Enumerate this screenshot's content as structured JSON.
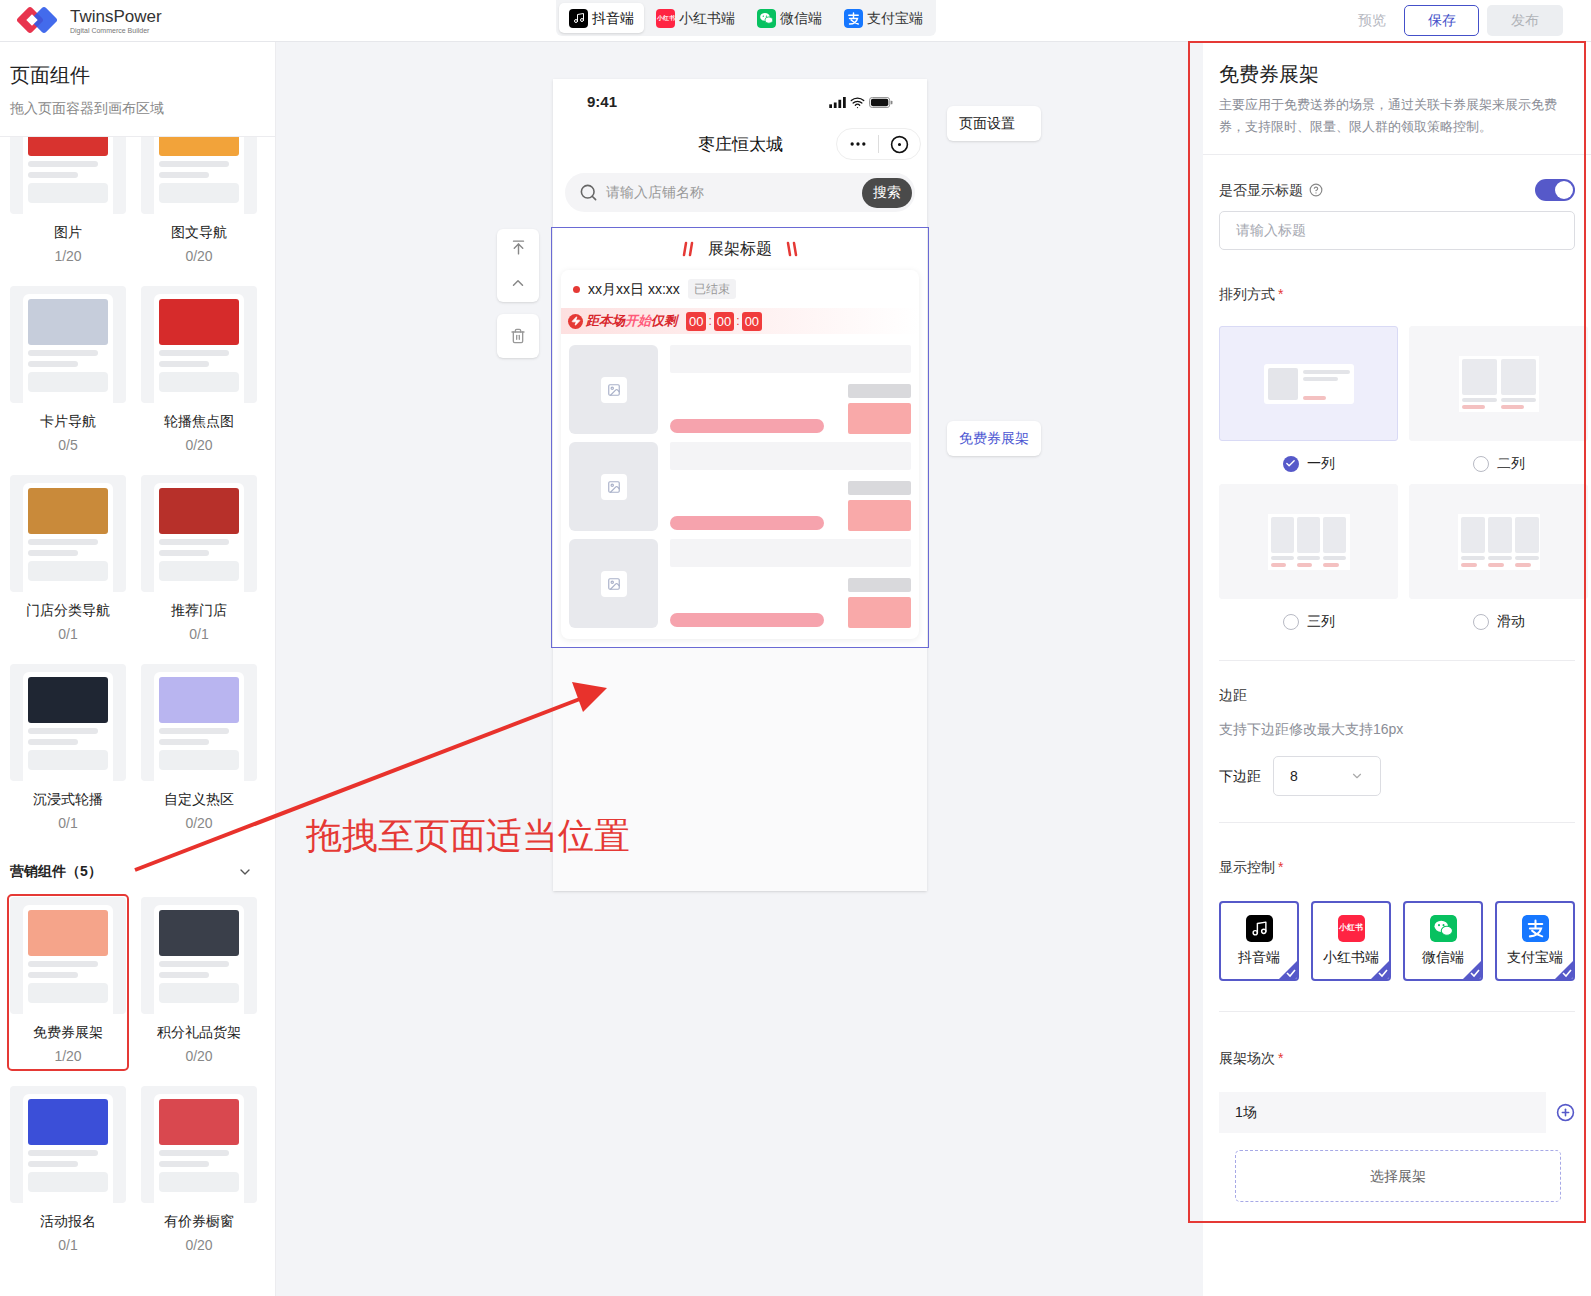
{
  "app": {
    "name": "TwinsPower",
    "tagline": "Digital Commerce Builder"
  },
  "platform_tabs": [
    {
      "label": "抖音端",
      "kind": "douyin",
      "selected": true
    },
    {
      "label": "小红书端",
      "kind": "xiaohongshu",
      "icon_text": "小红书",
      "selected": false
    },
    {
      "label": "微信端",
      "kind": "wechat",
      "selected": false
    },
    {
      "label": "支付宝端",
      "kind": "alipay",
      "selected": false
    }
  ],
  "toolbar": {
    "preview": {
      "label": "预览",
      "disabled": true
    },
    "save": {
      "label": "保存",
      "disabled": false
    },
    "publish": {
      "label": "发布",
      "disabled": true
    }
  },
  "component_panel": {
    "title": "页面组件",
    "subtitle": "拖入页面容器到画布区域",
    "basic_items": [
      {
        "label": "图片",
        "count": "1/20",
        "color": "#d8332f"
      },
      {
        "label": "图文导航",
        "count": "0/20",
        "color": "#f2a33a"
      },
      {
        "label": "卡片导航",
        "count": "0/5",
        "color": "#c6cddb"
      },
      {
        "label": "轮播焦点图",
        "count": "0/20",
        "color": "#d62b2b"
      },
      {
        "label": "门店分类导航",
        "count": "0/1",
        "color": "#c98a3a"
      },
      {
        "label": "推荐门店",
        "count": "0/1",
        "color": "#b7302a"
      },
      {
        "label": "沉浸式轮播",
        "count": "0/1",
        "color": "#1f2633"
      },
      {
        "label": "自定义热区",
        "count": "0/20",
        "color": "#b9b5f0"
      }
    ],
    "marketing_section": {
      "title": "营销组件（5）",
      "expanded": true
    },
    "marketing_items": [
      {
        "label": "免费券展架",
        "count": "1/20",
        "color": "#f5a48a",
        "selected": true
      },
      {
        "label": "积分礼品货架",
        "count": "0/20",
        "color": "#3a3f4a",
        "selected": false
      },
      {
        "label": "活动报名",
        "count": "0/1",
        "color": "#3b4fd8",
        "selected": false
      },
      {
        "label": "有价券橱窗",
        "count": "0/20",
        "color": "#d9484f",
        "selected": false
      }
    ]
  },
  "annotation": {
    "text": "拖拽至页面适当位置"
  },
  "canvas": {
    "page_settings_label": "页面设置",
    "selected_component_label": "免费券展架"
  },
  "phone": {
    "time": "9:41",
    "title": "枣庄恒太城",
    "search_placeholder": "请输入店铺名称",
    "search_button": "搜索",
    "shelf": {
      "title": "展架标题",
      "session_time": "xx月xx日 xx:xx",
      "session_status": "已结束",
      "countdown_label": [
        {
          "text": "距本场",
          "color": "#d8262c"
        },
        {
          "text": "开始",
          "color": "#ff5a7a"
        },
        {
          "text": "仅剩",
          "color": "#d8262c"
        }
      ],
      "countdown": [
        "00",
        "00",
        "00"
      ],
      "countdown_separator": ":",
      "coupons": [
        {
          "kind": "placeholder"
        },
        {
          "kind": "placeholder"
        },
        {
          "kind": "placeholder"
        }
      ]
    }
  },
  "settings": {
    "title": "免费券展架",
    "description": "主要应用于免费送券的场景，通过关联卡券展架来展示免费券，支持限时、限量、限人群的领取策略控制。",
    "required_mark": "*",
    "show_title": {
      "label": "是否显示标题",
      "on": true,
      "placeholder": "请输入标题"
    },
    "layout": {
      "label": "排列方式",
      "required": true,
      "options": [
        {
          "label": "一列",
          "kind": "one",
          "selected": true
        },
        {
          "label": "二列",
          "kind": "two",
          "selected": false
        },
        {
          "label": "三列",
          "kind": "three",
          "selected": false
        },
        {
          "label": "滑动",
          "kind": "slide",
          "selected": false
        }
      ]
    },
    "margin": {
      "label": "边距",
      "hint": "支持下边距修改最大支持16px",
      "field_label": "下边距",
      "value": "8"
    },
    "display_control": {
      "label": "显示控制",
      "required": true,
      "platforms": [
        {
          "label": "抖音端",
          "kind": "douyin",
          "checked": true
        },
        {
          "label": "小红书端",
          "kind": "xiaohongshu",
          "icon_text": "小红书",
          "checked": true
        },
        {
          "label": "微信端",
          "kind": "wechat",
          "checked": true
        },
        {
          "label": "支付宝端",
          "kind": "alipay",
          "checked": true
        }
      ]
    },
    "sessions": {
      "label": "展架场次",
      "required": true,
      "items": [
        {
          "label": "1场"
        }
      ],
      "select_button": "选择展架"
    }
  }
}
